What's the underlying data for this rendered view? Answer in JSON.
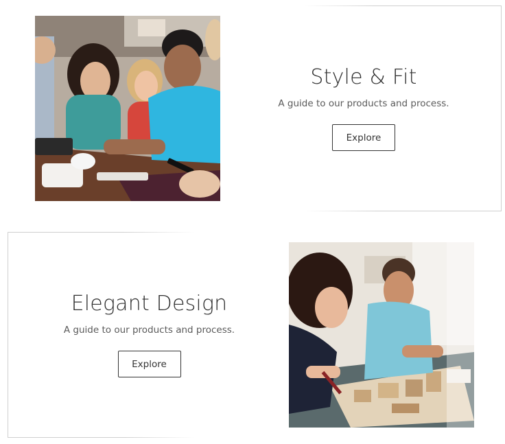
{
  "features": [
    {
      "title": "Style & Fit",
      "subtitle": "A guide to our products and process.",
      "button_label": "Explore",
      "image": "group-of-friends-using-phones-photo"
    },
    {
      "title": "Elegant Design",
      "subtitle": "A guide to our products and process.",
      "button_label": "Explore",
      "image": "designers-working-on-architecture-model-photo"
    }
  ],
  "colors": {
    "text": "#2f2f2f",
    "muted_text": "#5a5a5a",
    "border": "#cfcfcf",
    "button_border": "#333333"
  }
}
